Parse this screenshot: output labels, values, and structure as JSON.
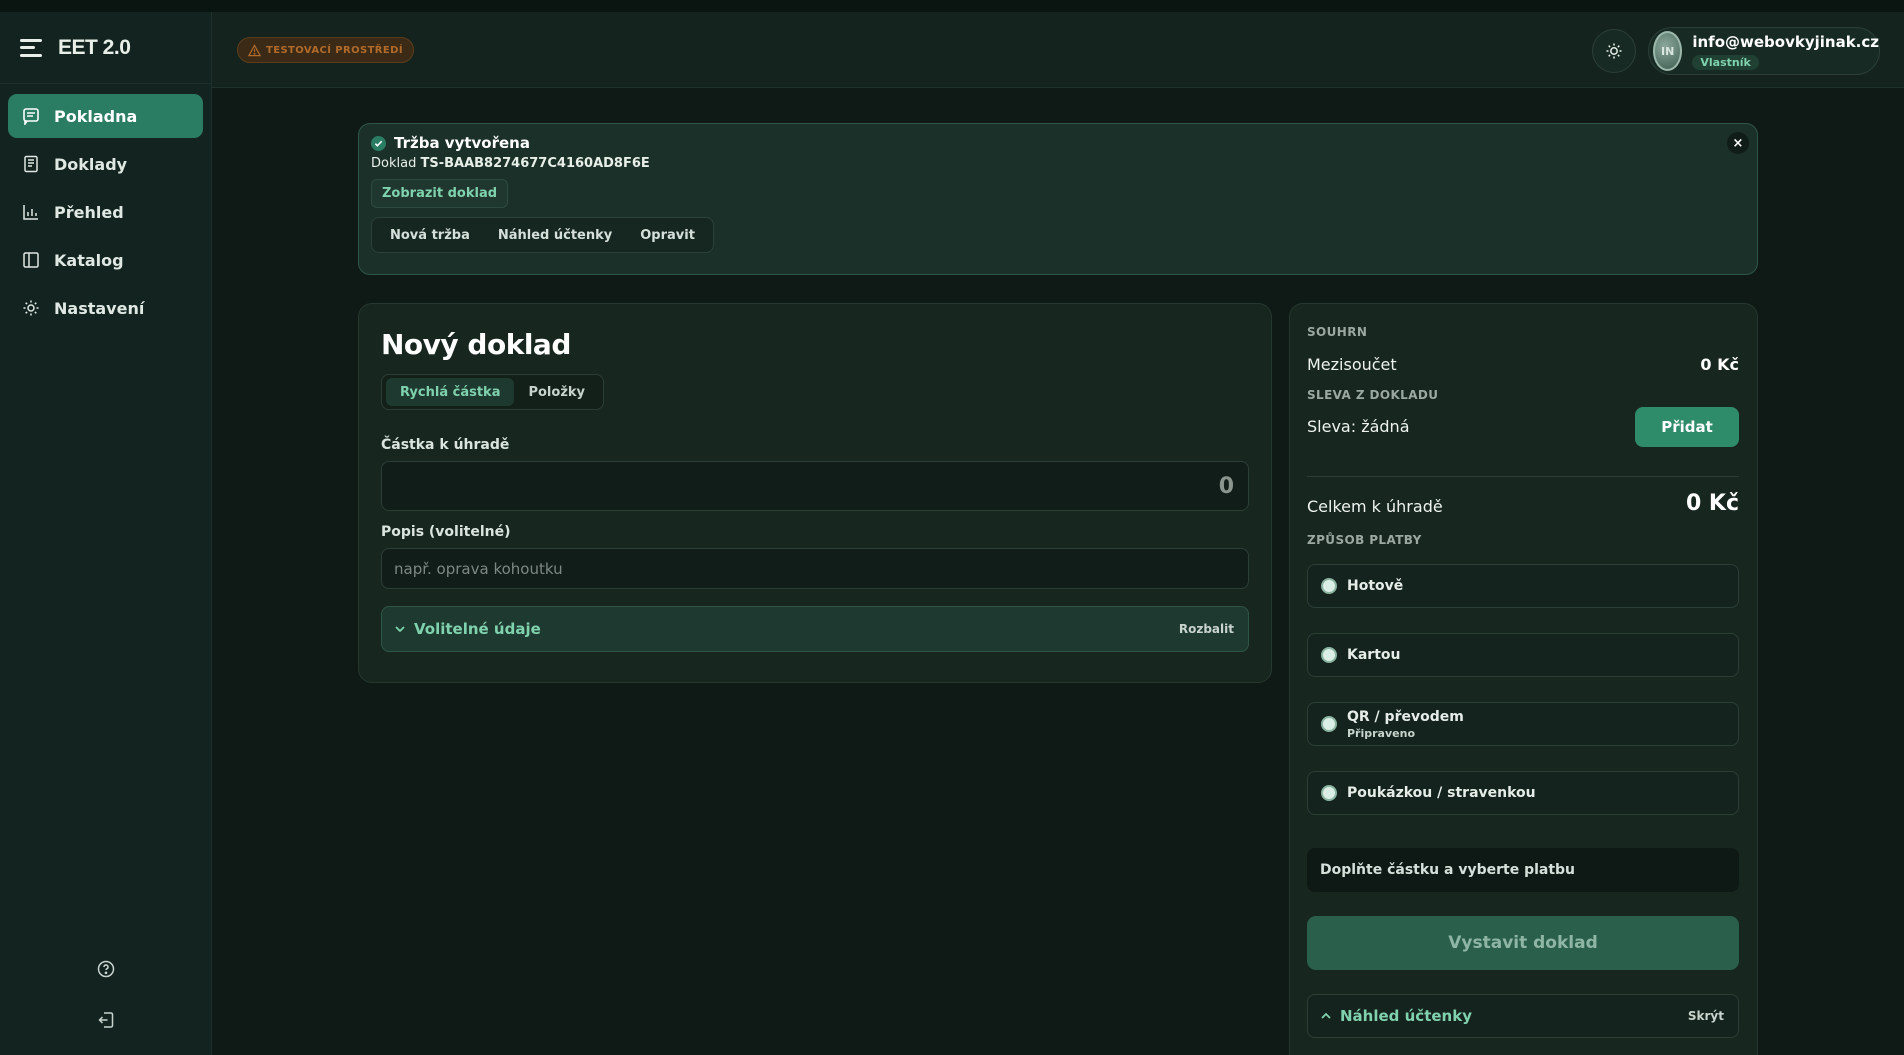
{
  "app": {
    "name": "EET 2.0"
  },
  "nav": [
    {
      "label": "Pokladna",
      "icon": "receipt-icon",
      "active": true
    },
    {
      "label": "Doklady",
      "icon": "document-icon",
      "active": false
    },
    {
      "label": "Přehled",
      "icon": "bar-chart-icon",
      "active": false
    },
    {
      "label": "Katalog",
      "icon": "book-icon",
      "active": false
    },
    {
      "label": "Nastavení",
      "icon": "gear-icon",
      "active": false
    }
  ],
  "header": {
    "env_badge": "TESTOVACÍ PROSTŘEDÍ",
    "user": {
      "initials": "IN",
      "email": "info@webovkyjinak.cz",
      "role": "Vlastník"
    }
  },
  "banner": {
    "title": "Tržba vytvořena",
    "doc_prefix": "Doklad",
    "doc_id": "TS-BAAB8274677C4160AD8F6E",
    "show_doc": "Zobrazit doklad",
    "actions": [
      "Nová tržba",
      "Náhled účtenky",
      "Opravit"
    ],
    "close": "×"
  },
  "new_doc": {
    "title": "Nový doklad",
    "tabs": [
      "Rychlá částka",
      "Položky"
    ],
    "amount_label": "Částka k úhradě",
    "amount_value": "0",
    "desc_label": "Popis (volitelné)",
    "desc_placeholder": "např. oprava kohoutku",
    "optional_label": "Volitelné údaje",
    "optional_toggle": "Rozbalit"
  },
  "summary": {
    "section": "SOUHRN",
    "subtotal_label": "Mezisoučet",
    "subtotal_value": "0 Kč",
    "discount_section": "SLEVA Z DOKLADU",
    "discount_label": "Sleva: žádná",
    "add_label": "Přidat",
    "total_label": "Celkem k úhradě",
    "total_value": "0 Kč",
    "payment_section": "ZPŮSOB PLATBY",
    "payments": [
      {
        "label": "Hotově",
        "sub": ""
      },
      {
        "label": "Kartou",
        "sub": ""
      },
      {
        "label": "QR / převodem",
        "sub": "Připraveno"
      },
      {
        "label": "Poukázkou / stravenkou",
        "sub": ""
      }
    ],
    "hint": "Doplňte částku a vyberte platbu",
    "issue_label": "Vystavit doklad",
    "preview_label": "Náhled účtenky",
    "preview_toggle": "Skrýt"
  }
}
